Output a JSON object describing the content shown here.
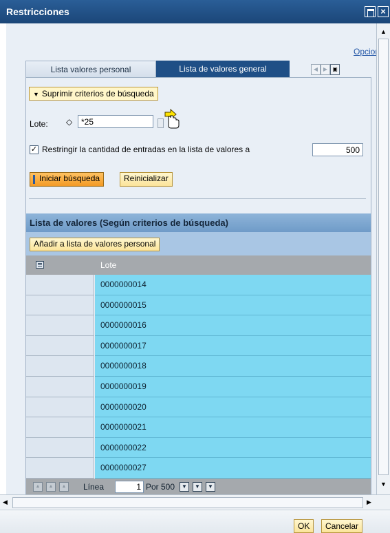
{
  "window": {
    "title": "Restricciones"
  },
  "header": {
    "options_link": "Opciones"
  },
  "tabs": [
    {
      "label": "Lista valores personal",
      "active": false
    },
    {
      "label": "Lista de valores general",
      "active": true
    }
  ],
  "search": {
    "suppress_label": "Suprimir criterios de búsqueda",
    "lote_label": "Lote:",
    "lote_value": "*25",
    "restrict_checked": true,
    "restrict_label": "Restringir la cantidad de entradas en la lista de valores a",
    "restrict_value": "500",
    "start_button": "Iniciar búsqueda",
    "reset_button": "Reinicializar"
  },
  "results": {
    "title": "Lista de valores (Según criterios de búsqueda)",
    "add_button": "Añadir a lista de valores personal",
    "column": "Lote",
    "rows": [
      "0000000014",
      "0000000015",
      "0000000016",
      "0000000017",
      "0000000018",
      "0000000019",
      "0000000020",
      "0000000021",
      "0000000022",
      "0000000027"
    ],
    "pager": {
      "line_label": "Línea",
      "line_value": "1",
      "per_label": "Por 500"
    }
  },
  "footer": {
    "ok_button": "OK",
    "cancel_button": "Cancelar"
  },
  "colors": {
    "title_bar": "#1b4678",
    "active_tab": "#1f4f86",
    "list_header": "#7fa6cf",
    "row_highlight": "#7ed8f2",
    "primary_button": "#f39a25",
    "secondary_button": "#fbe49a"
  }
}
